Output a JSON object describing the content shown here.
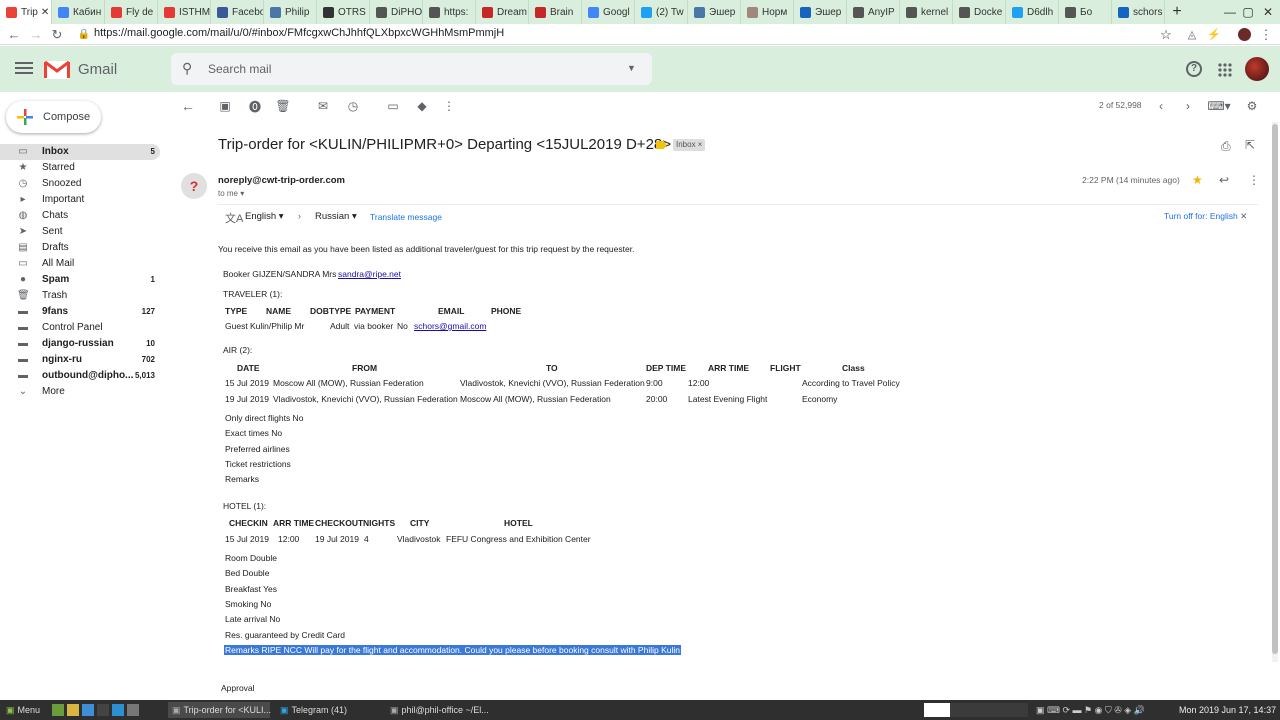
{
  "browser": {
    "tabs": [
      {
        "label": "Trip",
        "color": "#ea4335",
        "active": true
      },
      {
        "label": "Кабин",
        "color": "#4285f4"
      },
      {
        "label": "Fly de",
        "color": "#e53935"
      },
      {
        "label": "ISTHM",
        "color": "#e53935"
      },
      {
        "label": "Facebo",
        "color": "#3b5998"
      },
      {
        "label": "Philip",
        "color": "#4a76a8"
      },
      {
        "label": "OTRS",
        "color": "#333333"
      },
      {
        "label": "DiPHO",
        "color": "#555555"
      },
      {
        "label": "https:",
        "color": "#555555"
      },
      {
        "label": "Dream",
        "color": "#c62828"
      },
      {
        "label": "Brain",
        "color": "#c62828"
      },
      {
        "label": "Googl",
        "color": "#4285f4"
      },
      {
        "label": "(2) Tw",
        "color": "#1da1f2"
      },
      {
        "label": "Эшер",
        "color": "#4a76a8"
      },
      {
        "label": "Норм",
        "color": "#a1887f"
      },
      {
        "label": "Эшер",
        "color": "#1565c0"
      },
      {
        "label": "AnyIP",
        "color": "#555555"
      },
      {
        "label": "kernel",
        "color": "#555555"
      },
      {
        "label": "Docke",
        "color": "#555555"
      },
      {
        "label": "D6dlh",
        "color": "#1da1f2"
      },
      {
        "label": "Бо",
        "color": "#555555"
      },
      {
        "label": "schors",
        "color": "#1565c0"
      }
    ],
    "new_tab": "+",
    "url": "https://mail.google.com/mail/u/0/#inbox/FMfcgxwChJhhfQLXbpxcWGHhMsmPmmjH"
  },
  "gmail": {
    "logo": "Gmail",
    "search_placeholder": "Search mail",
    "compose": "Compose",
    "sidebar": [
      {
        "name": "Inbox",
        "count": "5",
        "bold": true,
        "selected": true,
        "icon": "▭"
      },
      {
        "name": "Starred",
        "count": "",
        "icon": "★"
      },
      {
        "name": "Snoozed",
        "count": "",
        "icon": "◷"
      },
      {
        "name": "Important",
        "count": "",
        "icon": "▸"
      },
      {
        "name": "Chats",
        "count": "",
        "icon": "◍"
      },
      {
        "name": "Sent",
        "count": "",
        "icon": "➤"
      },
      {
        "name": "Drafts",
        "count": "",
        "icon": "▤"
      },
      {
        "name": "All Mail",
        "count": "",
        "icon": "▭"
      },
      {
        "name": "Spam",
        "count": "1",
        "bold": true,
        "icon": "●"
      },
      {
        "name": "Trash",
        "count": "",
        "icon": "🗑"
      },
      {
        "name": "9fans",
        "count": "127",
        "bold": true,
        "icon": "▬"
      },
      {
        "name": "Control Panel",
        "count": "",
        "icon": "▬"
      },
      {
        "name": "django-russian",
        "count": "10",
        "bold": true,
        "icon": "▬"
      },
      {
        "name": "nginx-ru",
        "count": "702",
        "bold": true,
        "icon": "▬"
      },
      {
        "name": "outbound@dipho...",
        "count": "5,013",
        "bold": true,
        "icon": "▬"
      },
      {
        "name": "More",
        "count": "",
        "icon": "⌄"
      }
    ],
    "pager": "2 of 52,998",
    "subject": "Trip-order for <KULIN/PHILIPMR+0> Departing <15JUL2019 D+28>",
    "inbox_chip": "Inbox ×",
    "sender": "noreply@cwt-trip-order.com",
    "to": "to me",
    "time": "2:22 PM (14 minutes ago)",
    "translate": {
      "from": "English",
      "to": "Russian",
      "action": "Translate message",
      "turn_off": "Turn off for: English"
    }
  },
  "email": {
    "intro": "You receive this email as you have been listed as additional traveler/guest for this trip request by the requester.",
    "booker_prefix": "Booker GIJZEN/SANDRA Mrs",
    "booker_email": "sandra@ripe.net",
    "traveler_title": "TRAVELER (1):",
    "traveler_headers": [
      "TYPE",
      "NAME",
      "DOB",
      "TYPE",
      "PAYMENT",
      "EMAIL",
      "PHONE"
    ],
    "traveler_row": [
      "Guest",
      "Kulin/Philip Mr",
      "",
      "Adult",
      "via booker",
      "No",
      "schors@gmail.com"
    ],
    "air_title": "AIR (2):",
    "air_headers": [
      "DATE",
      "FROM",
      "TO",
      "DEP TIME",
      "ARR TIME",
      "FLIGHT",
      "Class"
    ],
    "air_rows": [
      [
        "15 Jul 2019",
        "Moscow All (MOW), Russian Federation",
        "Vladivostok, Knevichi (VVO), Russian Federation",
        "9:00",
        "12:00",
        "",
        "According to Travel Policy"
      ],
      [
        "19 Jul 2019",
        "Vladivostok, Knevichi (VVO), Russian Federation",
        "Moscow All (MOW), Russian Federation",
        "",
        "20:00",
        "Latest Evening Flight",
        "Economy"
      ]
    ],
    "air_notes": [
      "Only direct flights No",
      "Exact times No",
      "Preferred airlines",
      "Ticket restrictions",
      "Remarks"
    ],
    "hotel_title": "HOTEL (1):",
    "hotel_headers": [
      "CHECKIN",
      "ARR TIME",
      "CHECKOUT",
      "NIGHTS",
      "CITY",
      "HOTEL"
    ],
    "hotel_row": [
      "15 Jul 2019",
      "12:00",
      "19 Jul 2019",
      "4",
      "Vladivostok",
      "FEFU Congress and Exhibition Center"
    ],
    "hotel_notes": [
      "Room Double",
      "Bed Double",
      "Breakfast Yes",
      "Smoking No",
      "Late arrival No",
      "Res. guaranteed by Credit Card"
    ],
    "remarks_highlight": "Remarks RIPE NCC Will pay for the flight and accommodation. Could you please before booking consult with Philip Kulin",
    "approval": "Approval"
  },
  "taskbar": {
    "menu": "Menu",
    "tasks": [
      "Trip-order for <KULI...",
      "Telegram (41)",
      "phil@phil-office ~/El..."
    ],
    "clock": "Mon 2019 Jun 17, 14:37"
  }
}
